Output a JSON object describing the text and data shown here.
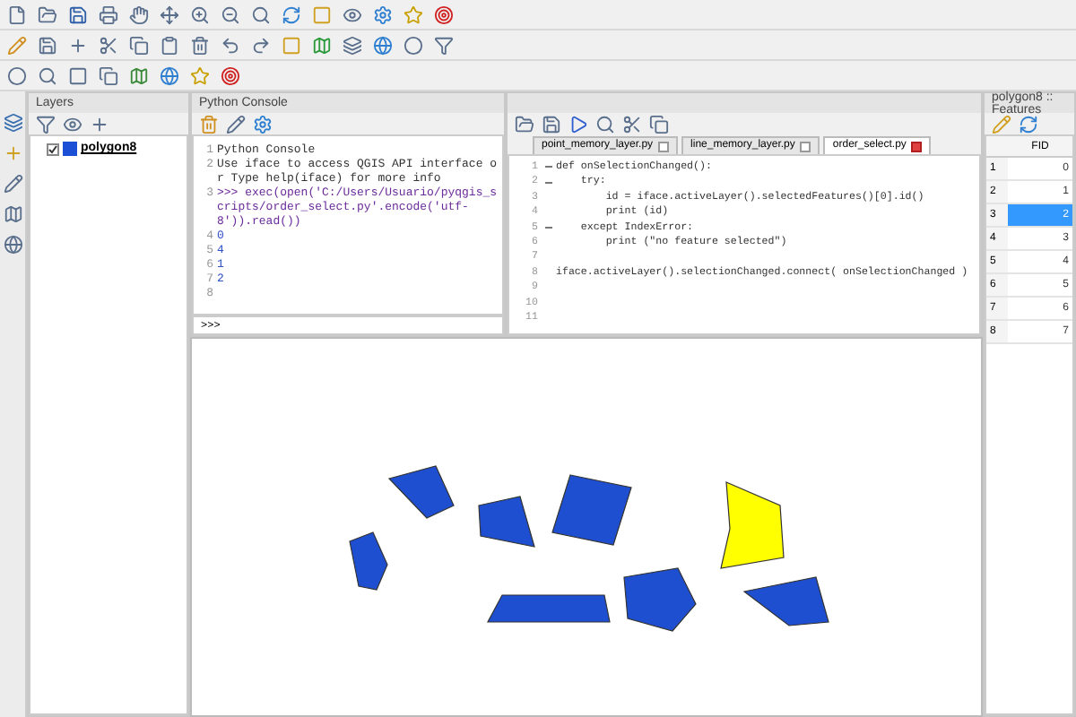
{
  "layers_panel": {
    "title": "Layers",
    "layers": [
      {
        "name": "polygon8",
        "checked": true,
        "color": "#1a4fd6"
      }
    ]
  },
  "python_console": {
    "title": "Python Console",
    "lines": [
      {
        "number": "1",
        "text": "Python Console",
        "kind": "info"
      },
      {
        "number": "2",
        "text": "Use iface to access QGIS API interface or Type help(iface) for more info",
        "kind": "info"
      },
      {
        "number": "3",
        "text": ">>> exec(open('C:/Users/Usuario/pyqgis_scripts/order_select.py'.encode('utf-8')).read())",
        "kind": "command"
      },
      {
        "number": "4",
        "text": "0",
        "kind": "output"
      },
      {
        "number": "5",
        "text": "4",
        "kind": "output"
      },
      {
        "number": "6",
        "text": "1",
        "kind": "output"
      },
      {
        "number": "7",
        "text": "2",
        "kind": "output"
      },
      {
        "number": "8"
      }
    ],
    "prompt": ">>>"
  },
  "editor": {
    "tabs": [
      {
        "label": "point_memory_layer.py",
        "selected": false
      },
      {
        "label": "line_memory_layer.py",
        "selected": false
      },
      {
        "label": "order_select.py",
        "selected": true
      }
    ],
    "lines": [
      {
        "number": "1",
        "text": "def onSelectionChanged():",
        "fold": true
      },
      {
        "number": "2",
        "text": "    try:",
        "fold": true
      },
      {
        "number": "3",
        "text": "        id = iface.activeLayer().selectedFeatures()[0].id()",
        "fold": false
      },
      {
        "number": "4",
        "text": "        print (id)",
        "fold": false
      },
      {
        "number": "5",
        "text": "    except IndexError:",
        "fold": true
      },
      {
        "number": "6",
        "text": "        print (\"no feature selected\")",
        "fold": false
      },
      {
        "number": "7",
        "fold": false
      },
      {
        "number": "8",
        "text": "iface.activeLayer().selectionChanged.connect( onSelectionChanged )",
        "fold": false
      },
      {
        "number": "9",
        "fold": false
      },
      {
        "number": "10",
        "fold": false
      },
      {
        "number": "11",
        "fold": false
      }
    ]
  },
  "attribute_table": {
    "title": "polygon8 :: Features",
    "columns": [
      "FID"
    ],
    "rows": [
      {
        "header": "1",
        "fid": "0",
        "selected": false
      },
      {
        "header": "2",
        "fid": "1",
        "selected": false
      },
      {
        "header": "3",
        "fid": "2",
        "selected": true
      },
      {
        "header": "4",
        "fid": "3",
        "selected": false
      },
      {
        "header": "5",
        "fid": "4",
        "selected": false
      },
      {
        "header": "6",
        "fid": "5",
        "selected": false
      },
      {
        "header": "7",
        "fid": "6",
        "selected": false
      },
      {
        "header": "8",
        "fid": "7",
        "selected": false
      }
    ]
  }
}
